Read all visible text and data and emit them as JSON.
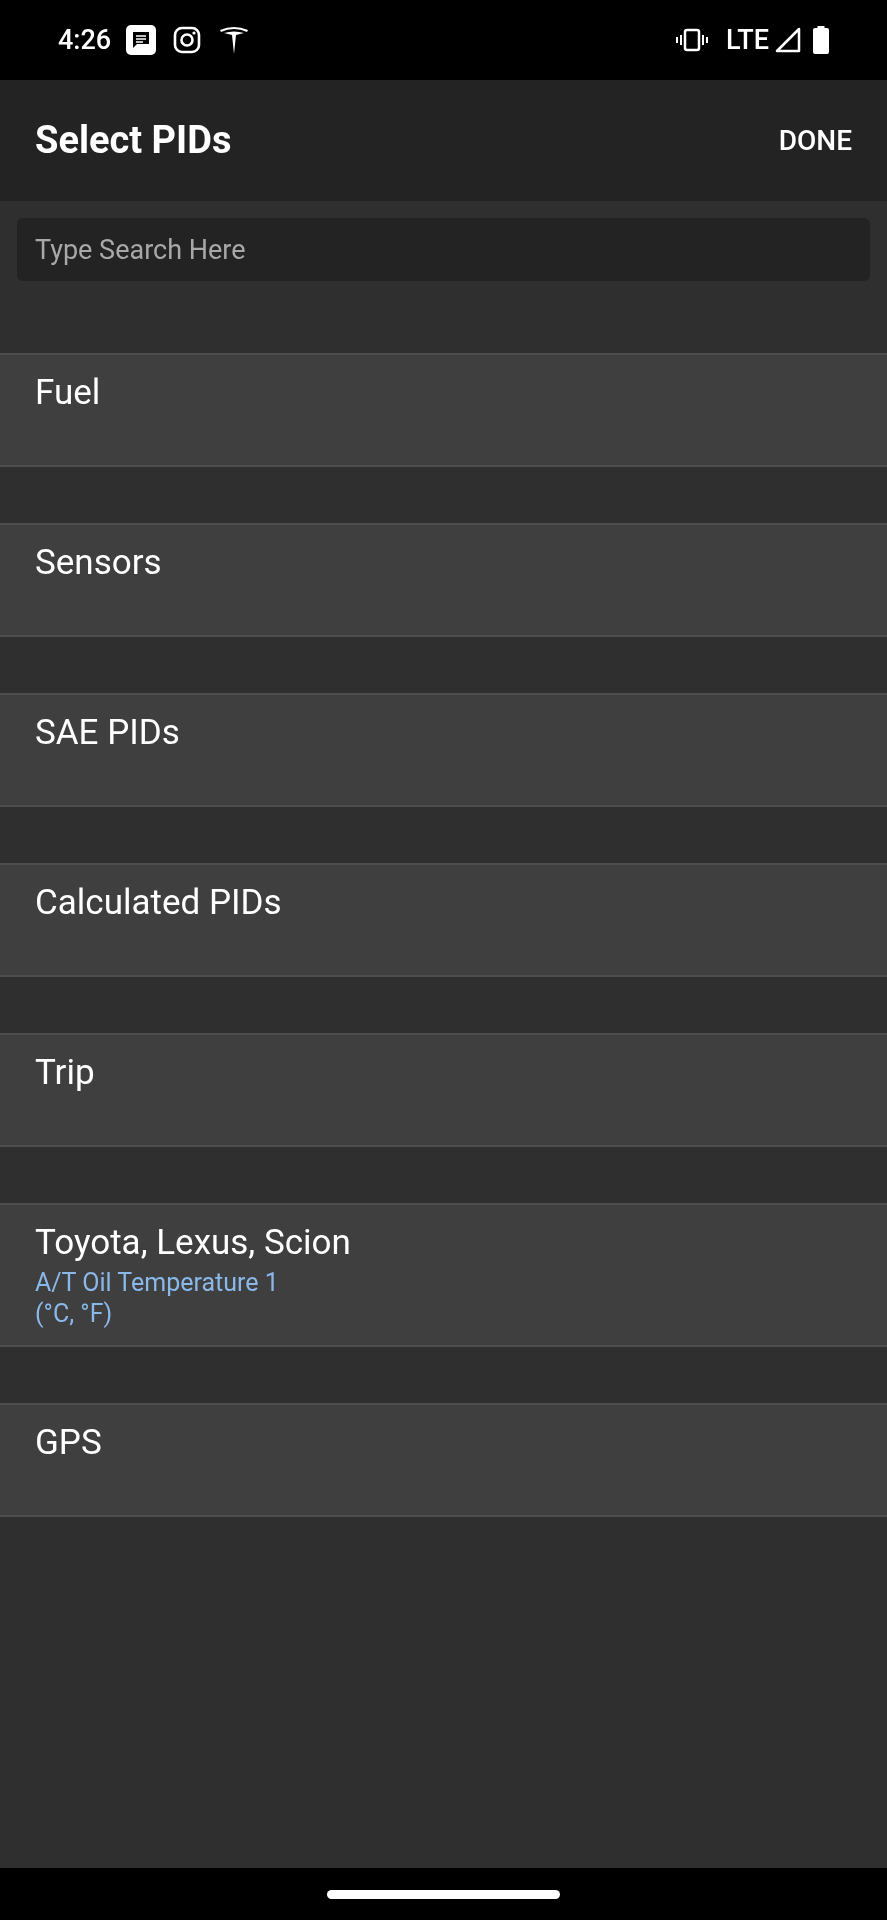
{
  "status_bar": {
    "time": "4:26",
    "network": "LTE"
  },
  "app_bar": {
    "title": "Select PIDs",
    "action": "DONE"
  },
  "search": {
    "placeholder": "Type Search Here"
  },
  "categories": [
    {
      "name": "Fuel"
    },
    {
      "name": "Sensors"
    },
    {
      "name": "SAE PIDs"
    },
    {
      "name": "Calculated PIDs"
    },
    {
      "name": "Trip"
    },
    {
      "name": "Toyota, Lexus, Scion",
      "selected_pids": [
        {
          "name": "A/T Oil Temperature 1",
          "units": "(°C, °F)"
        }
      ]
    },
    {
      "name": "GPS"
    }
  ]
}
